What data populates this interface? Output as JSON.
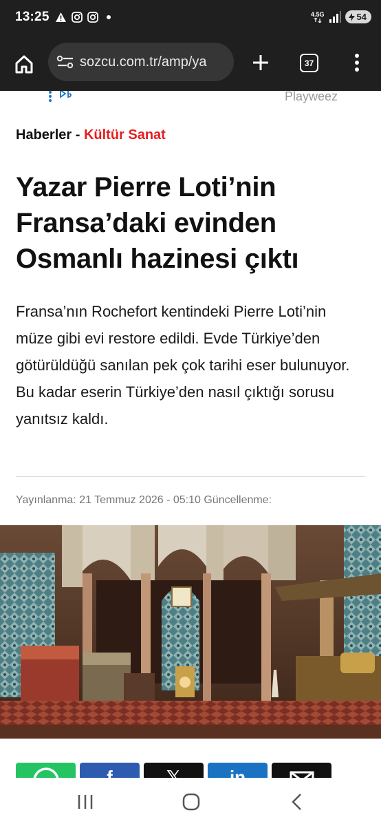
{
  "status_bar": {
    "time": "13:25",
    "network": "4.5G",
    "battery": "54",
    "notification_icons": [
      "alert-icon",
      "instagram-icon",
      "instagram-icon",
      "dot-icon"
    ]
  },
  "browser": {
    "url": "sozcu.com.tr/amp/ya",
    "tab_count": "37"
  },
  "ad": {
    "brand": "Playweez"
  },
  "article": {
    "breadcrumb_home": "Haberler",
    "breadcrumb_sep": " - ",
    "breadcrumb_category": "Kültür Sanat",
    "headline": "Yazar Pierre Loti’nin Fransa’daki evinden Osmanlı hazinesi çıktı",
    "summary": "Fransa’nın Rochefort kentindeki Pierre Loti’nin müze gibi evi restore edildi. Evde Türkiye’den götürüldüğü sanılan pek çok tarihi eser bulunuyor. Bu kadar eserin Türkiye’den nasıl çıktığı sorusu yanıtsız kaldı.",
    "meta": "Yayınlanma: 21 Temmuz 2026 - 05:10 Güncellenme:"
  },
  "share": {
    "facebook_glyph": "f",
    "x_glyph": "𝕏",
    "linkedin_glyph": "in"
  },
  "colors": {
    "accent_red": "#e41f1f",
    "whatsapp": "#25c463",
    "facebook": "#2d5bb0",
    "linkedin": "#1a73c2",
    "chrome_dark": "#1f1f1f"
  }
}
